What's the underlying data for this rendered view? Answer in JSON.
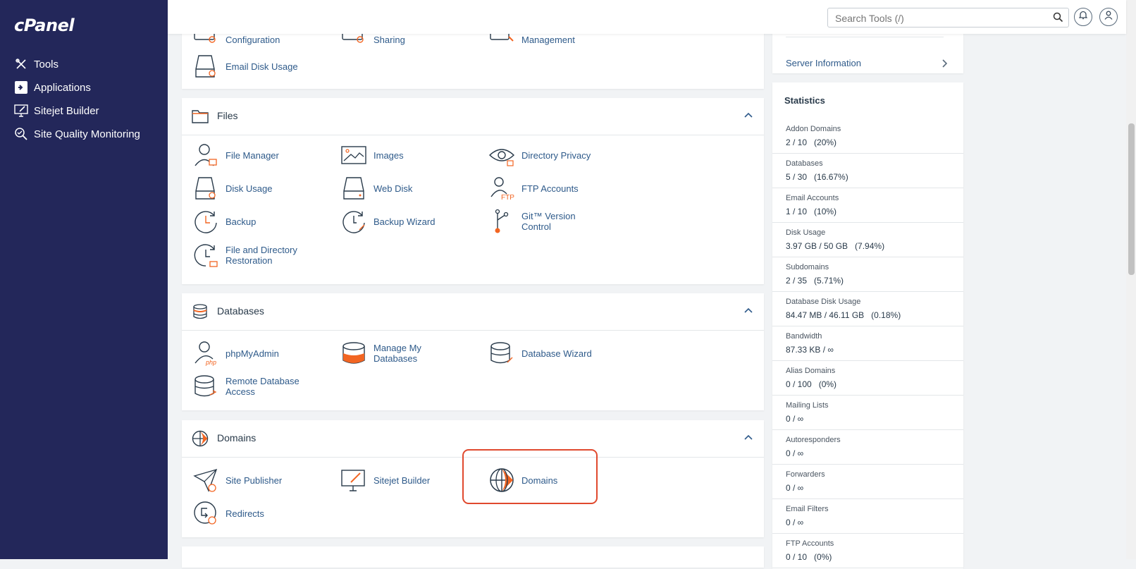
{
  "app": {
    "logo": "cPanel"
  },
  "sidebar": {
    "items": [
      {
        "label": "Tools",
        "icon": "tools-icon"
      },
      {
        "label": "Applications",
        "icon": "applications-icon"
      },
      {
        "label": "Sitejet Builder",
        "icon": "sitejet-icon"
      },
      {
        "label": "Site Quality Monitoring",
        "icon": "magnifier-icon"
      }
    ]
  },
  "header": {
    "search_placeholder": "Search Tools (/)",
    "search_value": ""
  },
  "email_panel": {
    "items": [
      "Configuration",
      "Sharing",
      "Management",
      "Email Disk Usage"
    ]
  },
  "files_panel": {
    "title": "Files",
    "items": [
      "File Manager",
      "Images",
      "Directory Privacy",
      "Disk Usage",
      "Web Disk",
      "FTP Accounts",
      "Backup",
      "Backup Wizard",
      "Git™ Version Control",
      "File and Directory Restoration"
    ]
  },
  "databases_panel": {
    "title": "Databases",
    "items": [
      "phpMyAdmin",
      "Manage My Databases",
      "Database Wizard",
      "Remote Database Access"
    ]
  },
  "domains_panel": {
    "title": "Domains",
    "items": [
      "Site Publisher",
      "Sitejet Builder",
      "Domains",
      "Redirects"
    ]
  },
  "right": {
    "server_info": "Server Information",
    "statistics_title": "Statistics",
    "stats": [
      {
        "label": "Addon Domains",
        "value": "2 / 10   (20%)"
      },
      {
        "label": "Databases",
        "value": "5 / 30   (16.67%)"
      },
      {
        "label": "Email Accounts",
        "value": "1 / 10   (10%)"
      },
      {
        "label": "Disk Usage",
        "value": "3.97 GB / 50 GB   (7.94%)"
      },
      {
        "label": "Subdomains",
        "value": "2 / 35   (5.71%)"
      },
      {
        "label": "Database Disk Usage",
        "value": "84.47 MB / 46.11 GB   (0.18%)"
      },
      {
        "label": "Bandwidth",
        "value": "87.33 KB / ∞"
      },
      {
        "label": "Alias Domains",
        "value": "0 / 100   (0%)"
      },
      {
        "label": "Mailing Lists",
        "value": "0 / ∞"
      },
      {
        "label": "Autoresponders",
        "value": "0 / ∞"
      },
      {
        "label": "Forwarders",
        "value": "0 / ∞"
      },
      {
        "label": "Email Filters",
        "value": "0 / ∞"
      },
      {
        "label": "FTP Accounts",
        "value": "0 / 10   (0%)"
      }
    ]
  },
  "colors": {
    "sidebar": "#23275a",
    "accent": "#f26522",
    "link": "#2e5a8a",
    "highlight": "#e0492e"
  }
}
